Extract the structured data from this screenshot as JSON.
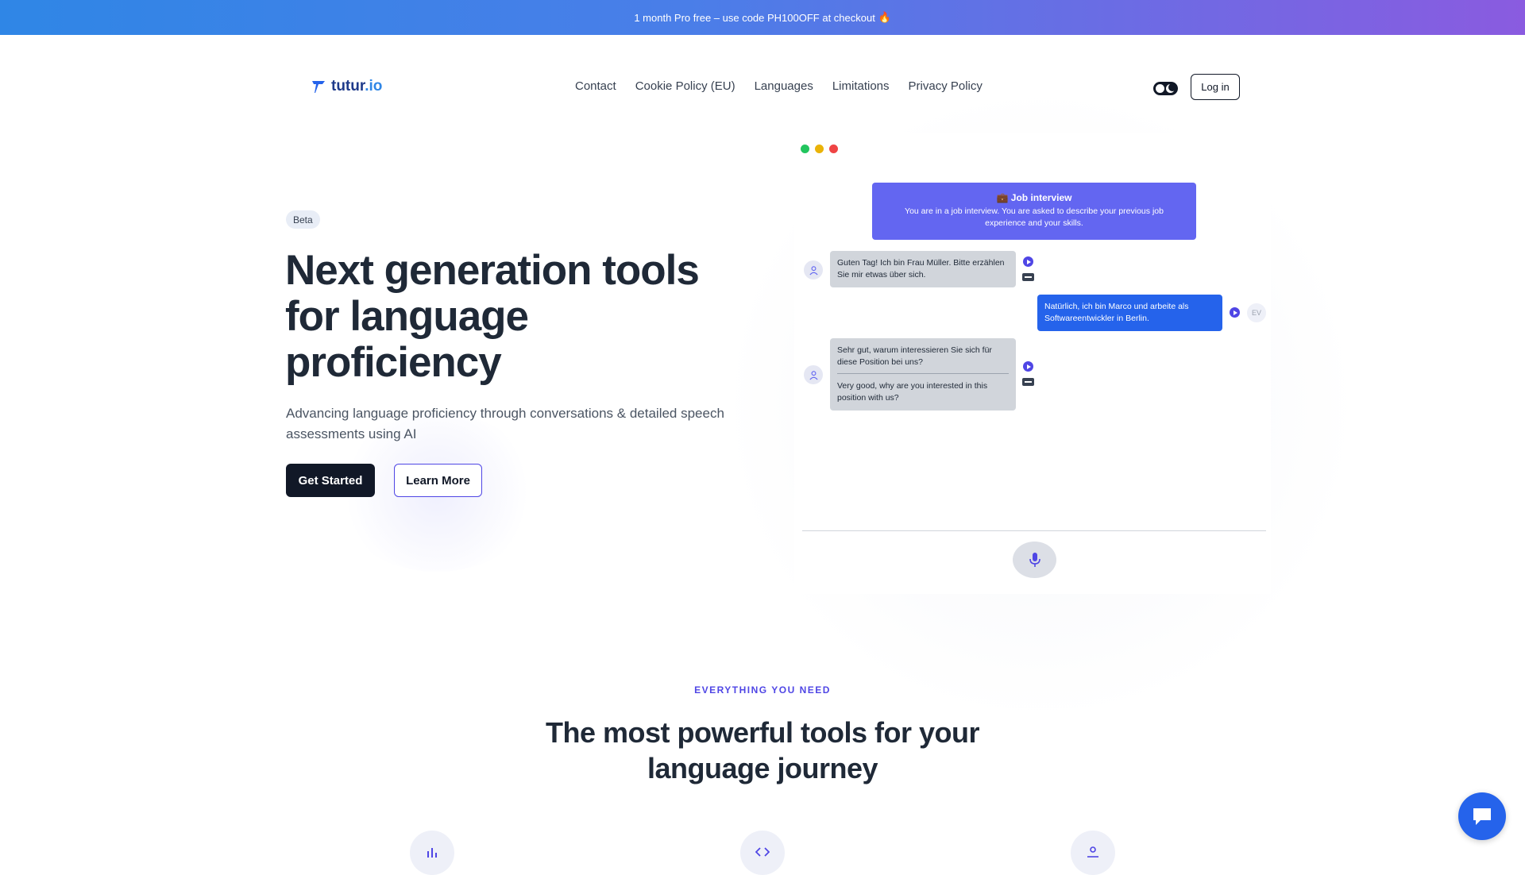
{
  "promo": {
    "text": "1 month Pro free – use code PH100OFF at checkout",
    "emoji": "🔥"
  },
  "nav": {
    "logo_text": "tutur",
    "logo_tld": ".io",
    "links": [
      "Contact",
      "Cookie Policy (EU)",
      "Languages",
      "Limitations",
      "Privacy Policy"
    ],
    "login_label": "Log in",
    "theme_toggle_icon": "theme-toggle-icon"
  },
  "hero": {
    "badge": "Beta",
    "title": "Next generation tools for language proficiency",
    "subtitle": "Advancing language proficiency through conversations & detailed speech assessments using AI",
    "primary_cta": "Get Started",
    "secondary_cta": "Learn More"
  },
  "demo": {
    "window_dots": [
      "#22c55e",
      "#eab308",
      "#ef4444"
    ],
    "scenario_title": "💼 Job interview",
    "scenario_desc": "You are in a job interview. You are asked to describe your previous job experience and your skills.",
    "messages": [
      {
        "role": "ai",
        "text": "Guten Tag! Ich bin Frau Müller. Bitte erzählen Sie mir etwas über sich."
      },
      {
        "role": "user",
        "text": "Natürlich, ich bin Marco und arbeite als Softwareentwickler in Berlin.",
        "avatar": "EV"
      },
      {
        "role": "ai",
        "text": "Sehr gut, warum interessieren Sie sich für diese Position bei uns?",
        "translation": "Very good, why are you interested in this position with us?"
      }
    ]
  },
  "features": {
    "eyebrow": "EVERYTHING YOU NEED",
    "title": "The most powerful tools for your language journey",
    "icons": [
      "bar-chart-icon",
      "code-icon",
      "person-icon"
    ]
  },
  "colors": {
    "accent": "#4f46e5",
    "dark": "#111827",
    "user_bubble": "#2563eb",
    "scenario": "#6366f1"
  }
}
